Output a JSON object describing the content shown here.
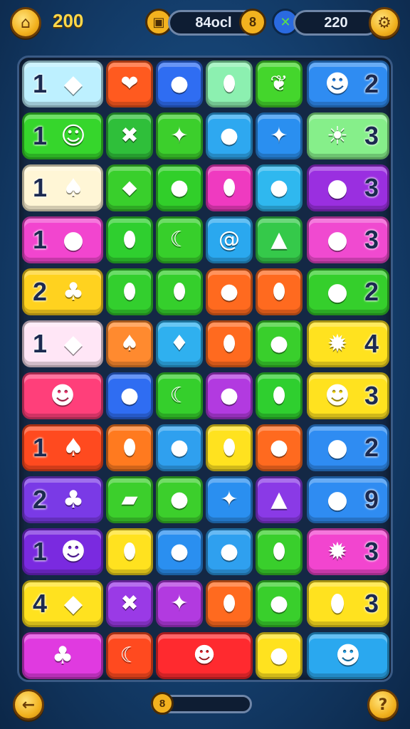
{
  "hud": {
    "coins": "200",
    "score_value": "84ocl",
    "score_badge": "8",
    "moves_value": "220",
    "icons": {
      "shop": "house-icon",
      "score": "chest-icon",
      "moves": "crossed-swords-icon",
      "settings": "gear-icon"
    }
  },
  "bottom": {
    "back_label": "←",
    "help_label": "?",
    "progress_badge": "8",
    "progress_percent": 12
  },
  "board": {
    "rows": [
      [
        {
          "kind": "wide",
          "color": "#bdf0ff",
          "num": "1",
          "num_side": "left",
          "icon": "blue-crystal-icon",
          "glyph": "◆"
        },
        {
          "kind": "cell",
          "color": "#ff5a1f",
          "icon": "red-heart-icon",
          "glyph": "❤"
        },
        {
          "kind": "cell",
          "color": "#2f6df2",
          "icon": "purple-fruit-icon",
          "glyph": "●"
        },
        {
          "kind": "cell",
          "color": "#8cf0b0",
          "icon": "lemon-icon",
          "glyph": "⬮"
        },
        {
          "kind": "cell",
          "color": "#44d62c",
          "icon": "leaf-icon",
          "glyph": "❦"
        },
        {
          "kind": "wide",
          "color": "#2f8cf2",
          "num": "2",
          "num_side": "right",
          "icon": "pink-monster-icon",
          "glyph": "☻"
        }
      ],
      [
        {
          "kind": "wide",
          "color": "#36d62c",
          "num": "1",
          "num_side": "left",
          "icon": "monkey-icon",
          "glyph": "☺"
        },
        {
          "kind": "cell",
          "color": "#2fbf3a",
          "icon": "green-x-icon",
          "glyph": "✖"
        },
        {
          "kind": "cell",
          "color": "#3ccf2c",
          "icon": "orange-star-icon",
          "glyph": "✦"
        },
        {
          "kind": "cell",
          "color": "#2ea8f0",
          "icon": "blue-berry-icon",
          "glyph": "●"
        },
        {
          "kind": "cell",
          "color": "#2a8ff0",
          "icon": "yellow-star-icon",
          "glyph": "✦"
        },
        {
          "kind": "wide",
          "color": "#86ef8a",
          "num": "3",
          "num_side": "right",
          "icon": "sun-face-icon",
          "glyph": "☀"
        }
      ],
      [
        {
          "kind": "wide",
          "color": "#fff6d6",
          "num": "1",
          "num_side": "left",
          "icon": "acorn-icon",
          "glyph": "♠"
        },
        {
          "kind": "cell",
          "color": "#39cf2c",
          "icon": "green-bottle-icon",
          "glyph": "⬥"
        },
        {
          "kind": "cell",
          "color": "#31cf2a",
          "icon": "green-apple-icon",
          "glyph": "●"
        },
        {
          "kind": "cell",
          "color": "#ef3ac0",
          "icon": "yellow-drop-icon",
          "glyph": "⬮"
        },
        {
          "kind": "cell",
          "color": "#2fb8ef",
          "icon": "green-apple-icon",
          "glyph": "●"
        },
        {
          "kind": "wide",
          "color": "#9a2fe0",
          "num": "3",
          "num_side": "right",
          "icon": "green-lime-icon",
          "glyph": "●"
        }
      ],
      [
        {
          "kind": "wide",
          "color": "#f245cf",
          "num": "1",
          "num_side": "left",
          "icon": "plum-icon",
          "glyph": "●"
        },
        {
          "kind": "cell",
          "color": "#2fcf2f",
          "icon": "red-drop-icon",
          "glyph": "⬮"
        },
        {
          "kind": "cell",
          "color": "#37cf2b",
          "icon": "banana-icon",
          "glyph": "☾"
        },
        {
          "kind": "cell",
          "color": "#2aa8ef",
          "icon": "swirl-icon",
          "glyph": "@"
        },
        {
          "kind": "cell",
          "color": "#35c94a",
          "icon": "blue-arrow-icon",
          "glyph": "▲"
        },
        {
          "kind": "wide",
          "color": "#f04ad0",
          "num": "3",
          "num_side": "right",
          "icon": "tomato-icon",
          "glyph": "●"
        }
      ],
      [
        {
          "kind": "wide",
          "color": "#ffd21f",
          "num": "2",
          "num_side": "left",
          "icon": "cupcake-icon",
          "glyph": "♣"
        },
        {
          "kind": "cell",
          "color": "#33cf2e",
          "icon": "green-drop-icon",
          "glyph": "⬮"
        },
        {
          "kind": "cell",
          "color": "#35cf2c",
          "icon": "green-leaf-icon",
          "glyph": "⬮"
        },
        {
          "kind": "cell",
          "color": "#ff6a1f",
          "icon": "red-pepper-icon",
          "glyph": "●"
        },
        {
          "kind": "cell",
          "color": "#ff6a1f",
          "icon": "red-drop-icon",
          "glyph": "⬮"
        },
        {
          "kind": "wide",
          "color": "#35cf2c",
          "num": "2",
          "num_side": "right",
          "icon": "plum-icon",
          "glyph": "●"
        }
      ],
      [
        {
          "kind": "wide",
          "color": "#ffe6f6",
          "num": "1",
          "num_side": "left",
          "icon": "blue-shell-icon",
          "glyph": "◆"
        },
        {
          "kind": "cell",
          "color": "#ff8a2f",
          "icon": "red-mushroom-icon",
          "glyph": "♠"
        },
        {
          "kind": "cell",
          "color": "#2fb0ef",
          "icon": "blue-bird-icon",
          "glyph": "♦"
        },
        {
          "kind": "cell",
          "color": "#ff6a1f",
          "icon": "yellow-drop-icon",
          "glyph": "⬮"
        },
        {
          "kind": "cell",
          "color": "#39cf2c",
          "icon": "green-turtle-icon",
          "glyph": "●"
        },
        {
          "kind": "wide",
          "color": "#ffe21f",
          "num": "4",
          "num_side": "right",
          "icon": "orange-cat-icon",
          "glyph": "✹"
        }
      ],
      [
        {
          "kind": "wide",
          "color": "#ff3f7a",
          "num": "",
          "num_side": "left",
          "icon": "green-blob-icon",
          "glyph": "☻"
        },
        {
          "kind": "cell",
          "color": "#2f6df2",
          "icon": "purple-berry-icon",
          "glyph": "●"
        },
        {
          "kind": "cell",
          "color": "#35cf2c",
          "icon": "banana-icon",
          "glyph": "☾"
        },
        {
          "kind": "cell",
          "color": "#b23ae0",
          "icon": "pink-onion-icon",
          "glyph": "●"
        },
        {
          "kind": "cell",
          "color": "#2fcf2f",
          "icon": "blue-drop-icon",
          "glyph": "⬮"
        },
        {
          "kind": "wide",
          "color": "#ffe21f",
          "num": "3",
          "num_side": "right",
          "icon": "green-frog-icon",
          "glyph": "☻"
        }
      ],
      [
        {
          "kind": "wide",
          "color": "#ff4a1f",
          "num": "1",
          "num_side": "left",
          "icon": "acorn-icon",
          "glyph": "♠"
        },
        {
          "kind": "cell",
          "color": "#ff7a1f",
          "icon": "yellow-drop-icon",
          "glyph": "⬮"
        },
        {
          "kind": "cell",
          "color": "#2fa0ef",
          "icon": "purple-fruit-icon",
          "glyph": "●"
        },
        {
          "kind": "cell",
          "color": "#ffe21f",
          "icon": "green-leaf-icon",
          "glyph": "⬮"
        },
        {
          "kind": "cell",
          "color": "#ff6a1f",
          "icon": "red-strawberry-icon",
          "glyph": "●"
        },
        {
          "kind": "wide",
          "color": "#2f8cf2",
          "num": "2",
          "num_side": "right",
          "icon": "green-apple-icon",
          "glyph": "●"
        }
      ],
      [
        {
          "kind": "wide",
          "color": "#7a3ae6",
          "num": "2",
          "num_side": "left",
          "icon": "orange-cupcake-icon",
          "glyph": "♣"
        },
        {
          "kind": "cell",
          "color": "#3ccf2c",
          "icon": "yellow-candle-icon",
          "glyph": "▰"
        },
        {
          "kind": "cell",
          "color": "#3ccf2c",
          "icon": "green-turtle-icon",
          "glyph": "●"
        },
        {
          "kind": "cell",
          "color": "#2a8ff0",
          "icon": "purple-star-icon",
          "glyph": "✦"
        },
        {
          "kind": "cell",
          "color": "#8a3ae6",
          "icon": "pink-arrow-icon",
          "glyph": "▲"
        },
        {
          "kind": "wide",
          "color": "#2f8cf2",
          "num": "9",
          "num_side": "right",
          "icon": "pink-ball-icon",
          "glyph": "●"
        }
      ],
      [
        {
          "kind": "wide",
          "color": "#7a2ae0",
          "num": "1",
          "num_side": "left",
          "icon": "green-face-icon",
          "glyph": "☻"
        },
        {
          "kind": "cell",
          "color": "#ffe21f",
          "icon": "orange-drop-icon",
          "glyph": "⬮"
        },
        {
          "kind": "cell",
          "color": "#2a8ff0",
          "icon": "purple-fruit-icon",
          "glyph": "●"
        },
        {
          "kind": "cell",
          "color": "#2fa0ef",
          "icon": "purple-plum-icon",
          "glyph": "●"
        },
        {
          "kind": "cell",
          "color": "#39cf2c",
          "icon": "green-leaf-icon",
          "glyph": "⬮"
        },
        {
          "kind": "wide",
          "color": "#f245cf",
          "num": "3",
          "num_side": "right",
          "icon": "orange-cat-icon",
          "glyph": "✹"
        }
      ],
      [
        {
          "kind": "wide",
          "color": "#ffe21f",
          "num": "4",
          "num_side": "left",
          "icon": "blue-shell-icon",
          "glyph": "◆"
        },
        {
          "kind": "cell",
          "color": "#9a3ae6",
          "icon": "purple-x-icon",
          "glyph": "✖"
        },
        {
          "kind": "cell",
          "color": "#b23ae0",
          "icon": "pink-star-icon",
          "glyph": "✦"
        },
        {
          "kind": "cell",
          "color": "#ff6a1f",
          "icon": "green-leaf-icon",
          "glyph": "⬮"
        },
        {
          "kind": "cell",
          "color": "#39cf2c",
          "icon": "green-apple-icon",
          "glyph": "●"
        },
        {
          "kind": "wide",
          "color": "#ffe21f",
          "num": "3",
          "num_side": "right",
          "icon": "red-tomato-icon",
          "glyph": "⬮"
        }
      ],
      [
        {
          "kind": "wide",
          "color": "#e03ae0",
          "num": "",
          "num_side": "left",
          "icon": "cupcake-icon",
          "glyph": "♣"
        },
        {
          "kind": "cell",
          "color": "#ff4a1f",
          "icon": "green-banana-icon",
          "glyph": "☾"
        },
        {
          "kind": "cell2",
          "color": "#ff2a2f",
          "icon": "pink-monster-icon",
          "glyph": "☻"
        },
        {
          "kind": "cell",
          "color": "#ffe21f",
          "icon": "blue-berry-icon",
          "glyph": "●"
        },
        {
          "kind": "wide",
          "color": "#2aa8ef",
          "num": "",
          "num_side": "right",
          "icon": "pink-monster-icon",
          "glyph": "☻"
        }
      ]
    ]
  }
}
